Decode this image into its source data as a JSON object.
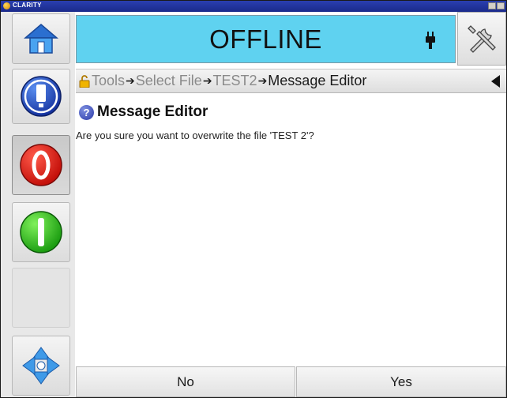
{
  "window": {
    "app_title": "CLARITY"
  },
  "header": {
    "status": "OFFLINE",
    "status_color": "#5fd2f0"
  },
  "left_panel": {
    "home_icon": "home-icon",
    "info_icon": "printer-info-icon",
    "stop_icon": "red-stop-icon",
    "start_icon": "green-start-icon",
    "navigate_icon": "four-way-arrow-icon"
  },
  "breadcrumb": {
    "items": [
      "Tools",
      "Select File",
      "TEST2",
      "Message Editor"
    ],
    "separator": "➔"
  },
  "dialog": {
    "title": "Message Editor",
    "message": "Are you sure you want to overwrite the file 'TEST 2'?"
  },
  "buttons": {
    "no": "No",
    "yes": "Yes"
  }
}
